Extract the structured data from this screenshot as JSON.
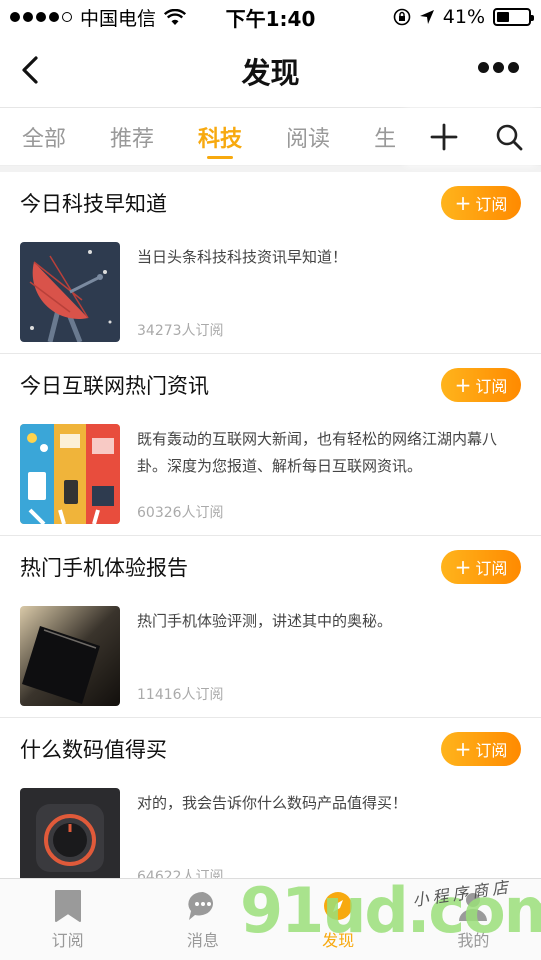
{
  "status_bar": {
    "carrier": "中国电信",
    "time": "下午1:40",
    "battery": "41%",
    "battery_level": 0.41
  },
  "nav": {
    "title": "发现"
  },
  "tabs": [
    {
      "label": "全部",
      "active": false
    },
    {
      "label": "推荐",
      "active": false
    },
    {
      "label": "科技",
      "active": true
    },
    {
      "label": "阅读",
      "active": false
    },
    {
      "label": "生",
      "active": false
    }
  ],
  "subscribe_label": "订阅",
  "items": [
    {
      "title": "今日科技早知道",
      "desc": "当日头条科技科技资讯早知道！",
      "count": "34273人订阅"
    },
    {
      "title": "今日互联网热门资讯",
      "desc": "既有轰动的互联网大新闻，也有轻松的网络江湖内幕八卦。深度为您报道、解析每日互联网资讯。",
      "count": "60326人订阅"
    },
    {
      "title": "热门手机体验报告",
      "desc": "热门手机体验评测，讲述其中的奥秘。",
      "count": "11416人订阅"
    },
    {
      "title": "什么数码值得买",
      "desc": "对的，我会告诉你什么数码产品值得买！",
      "count": "64622人订阅"
    }
  ],
  "tabbar": [
    {
      "label": "订阅",
      "icon": "bookmark-icon",
      "active": false
    },
    {
      "label": "消息",
      "icon": "chat-bubble-icon",
      "active": false
    },
    {
      "label": "发现",
      "icon": "discover-icon",
      "active": true
    },
    {
      "label": "我的",
      "icon": "user-icon",
      "active": false
    }
  ],
  "watermark": {
    "main": "91ud.com",
    "sub": "小程序商店"
  },
  "colors": {
    "accent": "#f7a90f",
    "button_gradient_start": "#ffb41c",
    "button_gradient_end": "#ff8a00"
  }
}
